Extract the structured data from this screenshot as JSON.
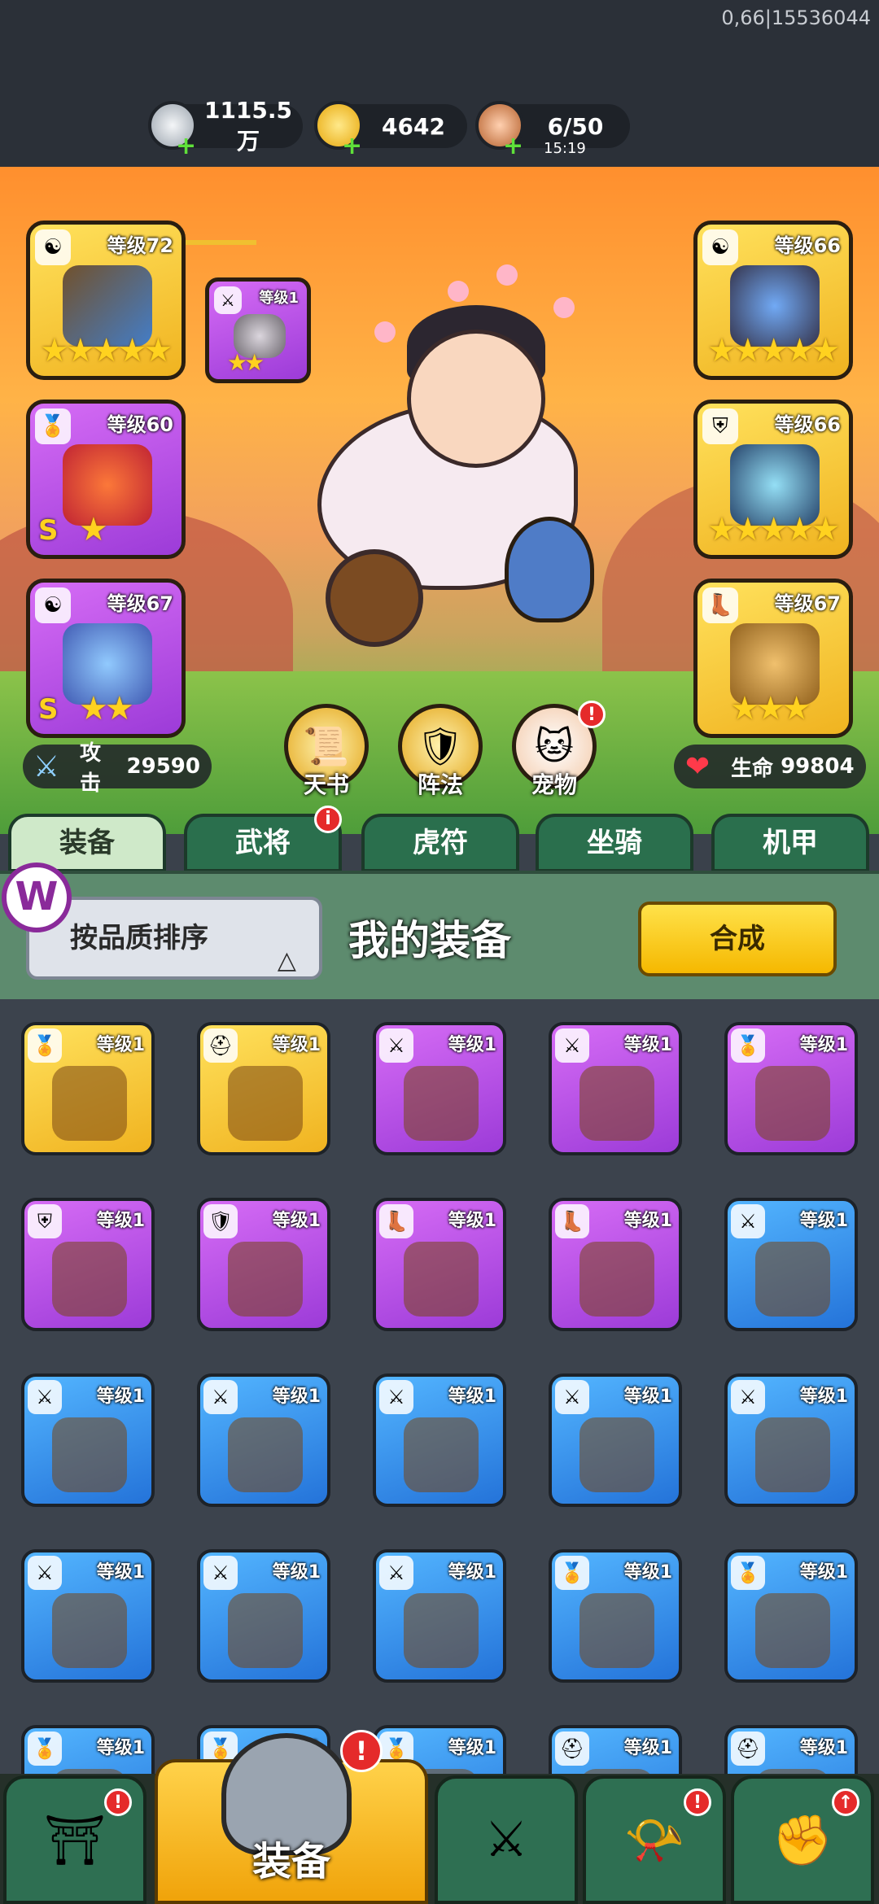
{
  "build_id": "0,66|15536044",
  "resources": {
    "silver": {
      "value": "1115.5万",
      "icon": "silver-coin-icon"
    },
    "gold": {
      "value": "4642",
      "icon": "gold-ingot-icon"
    },
    "stamina": {
      "value": "6/50",
      "timer": "15:19",
      "icon": "meat-icon"
    }
  },
  "equipped": {
    "left": [
      {
        "level": "等级72",
        "rarity": "gold",
        "stars": "★★★★★",
        "category": "yin-yang-icon"
      },
      {
        "level": "等级60",
        "rarity": "purple",
        "stars": "★",
        "rank": "S",
        "category": "medal-icon"
      },
      {
        "level": "等级67",
        "rarity": "purple",
        "stars": "★★",
        "rank": "S",
        "category": "yin-yang-icon"
      }
    ],
    "right": [
      {
        "level": "等级66",
        "rarity": "gold",
        "stars": "★★★★★",
        "category": "yin-yang-icon"
      },
      {
        "level": "等级66",
        "rarity": "gold",
        "stars": "★★★★★",
        "category": "armor-icon"
      },
      {
        "level": "等级67",
        "rarity": "gold",
        "stars": "★★★",
        "category": "boots-icon"
      }
    ],
    "weapon_small": {
      "level": "等级1",
      "stars": "★★"
    }
  },
  "stats": {
    "attack_label": "攻击",
    "attack_value": "29590",
    "hp_label": "生命",
    "hp_value": "99804"
  },
  "functions": [
    {
      "label": "天书",
      "icon": "scroll-icon"
    },
    {
      "label": "阵法",
      "icon": "formation-icon"
    },
    {
      "label": "宠物",
      "icon": "pet-cat-icon",
      "badge": "!"
    }
  ],
  "tabs": [
    {
      "label": "装备",
      "active": true
    },
    {
      "label": "武将",
      "badge": "i"
    },
    {
      "label": "虎符"
    },
    {
      "label": "坐骑"
    },
    {
      "label": "机甲"
    }
  ],
  "panel": {
    "sort_label": "按品质排序",
    "sort_arrow": "△",
    "title": "我的装备",
    "merge_label": "合成",
    "logo_text": "W"
  },
  "inventory": [
    {
      "level": "等级1",
      "rarity": "gold",
      "category": "medal-icon"
    },
    {
      "level": "等级1",
      "rarity": "gold",
      "category": "helmet-icon"
    },
    {
      "level": "等级1",
      "rarity": "purple",
      "category": "sword-icon"
    },
    {
      "level": "等级1",
      "rarity": "purple",
      "category": "sword-icon"
    },
    {
      "level": "等级1",
      "rarity": "purple",
      "category": "medal-icon"
    },
    {
      "level": "等级1",
      "rarity": "purple",
      "category": "armor-icon"
    },
    {
      "level": "等级1",
      "rarity": "purple",
      "category": "bracer-icon"
    },
    {
      "level": "等级1",
      "rarity": "purple",
      "category": "boots-icon"
    },
    {
      "level": "等级1",
      "rarity": "purple",
      "category": "boots-icon"
    },
    {
      "level": "等级1",
      "rarity": "blue",
      "category": "sword-icon"
    },
    {
      "level": "等级1",
      "rarity": "blue",
      "category": "sword-icon"
    },
    {
      "level": "等级1",
      "rarity": "blue",
      "category": "sword-icon"
    },
    {
      "level": "等级1",
      "rarity": "blue",
      "category": "sword-icon"
    },
    {
      "level": "等级1",
      "rarity": "blue",
      "category": "sword-icon"
    },
    {
      "level": "等级1",
      "rarity": "blue",
      "category": "sword-icon"
    },
    {
      "level": "等级1",
      "rarity": "blue",
      "category": "sword-icon"
    },
    {
      "level": "等级1",
      "rarity": "blue",
      "category": "sword-icon"
    },
    {
      "level": "等级1",
      "rarity": "blue",
      "category": "sword-icon"
    },
    {
      "level": "等级1",
      "rarity": "blue",
      "category": "medal-icon"
    },
    {
      "level": "等级1",
      "rarity": "blue",
      "category": "medal-icon"
    },
    {
      "level": "等级1",
      "rarity": "blue",
      "category": "medal-icon"
    },
    {
      "level": "等级1",
      "rarity": "blue",
      "category": "medal-icon"
    },
    {
      "level": "等级1",
      "rarity": "blue",
      "category": "medal-icon"
    },
    {
      "level": "等级1",
      "rarity": "blue",
      "category": "helmet-icon"
    },
    {
      "level": "等级1",
      "rarity": "blue",
      "category": "helmet-icon"
    }
  ],
  "bottom_nav": [
    {
      "icon": "gate-icon",
      "badge": "!"
    },
    {
      "label": "装备",
      "icon": "helmet-icon",
      "badge": "!",
      "active": true
    },
    {
      "icon": "crossed-swords-icon"
    },
    {
      "icon": "horn-icon",
      "badge": "!"
    },
    {
      "icon": "fist-upgrade-icon",
      "badge": "↑"
    }
  ]
}
